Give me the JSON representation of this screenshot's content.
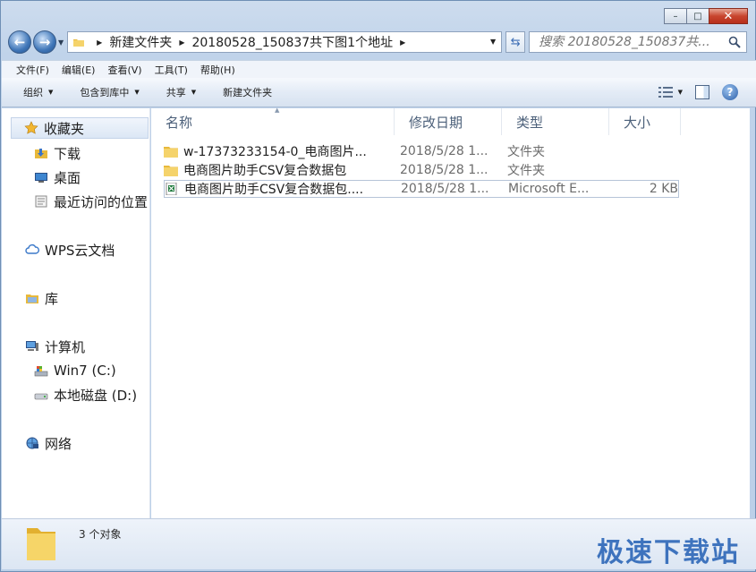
{
  "window": {
    "min_label": "–",
    "max_label": "□",
    "close_label": "✕"
  },
  "nav": {
    "back_glyph": "←",
    "forward_glyph": "→",
    "address": {
      "crumbs": [
        "新建文件夹",
        "20180528_150837共下图1个地址"
      ]
    },
    "search_placeholder": "搜索 20180528_150837共..."
  },
  "menubar": {
    "items": [
      "文件(F)",
      "编辑(E)",
      "查看(V)",
      "工具(T)",
      "帮助(H)"
    ]
  },
  "toolbar": {
    "organize": "组织",
    "include_library": "包含到库中",
    "share": "共享",
    "new_folder": "新建文件夹"
  },
  "navpane": {
    "favorites": "收藏夹",
    "downloads": "下载",
    "desktop": "桌面",
    "recent": "最近访问的位置",
    "wps": "WPS云文档",
    "libraries": "库",
    "computer": "计算机",
    "drive_c": "Win7 (C:)",
    "drive_d": "本地磁盘 (D:)",
    "network": "网络"
  },
  "columns": {
    "name": "名称",
    "date": "修改日期",
    "type": "类型",
    "size": "大小"
  },
  "files": [
    {
      "name": "w-17373233154-0_电商图片...",
      "date": "2018/5/28 1...",
      "type": "文件夹",
      "size": "",
      "icon": "folder-icon"
    },
    {
      "name": "电商图片助手CSV复合数据包",
      "date": "2018/5/28 1...",
      "type": "文件夹",
      "size": "",
      "icon": "folder-icon"
    },
    {
      "name": "电商图片助手CSV复合数据包....",
      "date": "2018/5/28 1...",
      "type": "Microsoft E...",
      "size": "2 KB",
      "icon": "excel-csv-icon"
    }
  ],
  "status": {
    "count": "3 个对象",
    "watermark": "极速下载站"
  },
  "colors": {
    "frame": "#c0d3ea",
    "accent": "#2d67b8",
    "folder": "#f2c650"
  }
}
